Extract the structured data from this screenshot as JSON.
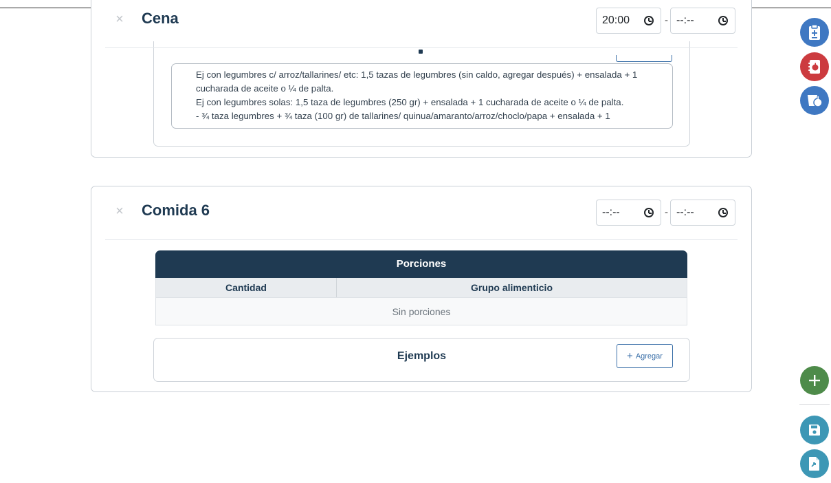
{
  "meals": [
    {
      "title": "Cena",
      "time_from": "20:00",
      "time_to": "--:--",
      "examples_text": [
        "Ej con legumbres c/ arroz/tallarines/ etc: 1,5 tazas de legumbres (sin caldo, agregar después) + ensalada + 1",
        "cucharada de aceite o ¼ de palta.",
        "Ej con legumbres solas: 1,5 taza de legumbres (250 gr) + ensalada + 1 cucharada de aceite o ¼ de palta.",
        "- ¾ taza legumbres + ¾ taza (100 gr) de tallarines/ quinua/amaranto/arroz/choclo/papa +  ensalada + 1"
      ]
    },
    {
      "title": "Comida 6",
      "time_from": "--:--",
      "time_to": "--:--",
      "portions": {
        "title": "Porciones",
        "columns": [
          "Cantidad",
          "Grupo alimenticio"
        ],
        "empty_text": "Sin porciones"
      },
      "examples": {
        "title": "Ejemplos",
        "add_label": "Agregar"
      }
    }
  ],
  "time_separator": "-",
  "close_glyph": "×",
  "floating_buttons": [
    {
      "icon": "clipboard-plus-icon",
      "color": "#3f78c2"
    },
    {
      "icon": "notebook-apple-icon",
      "color": "#cc3b3f"
    },
    {
      "icon": "fruit-bowl-icon",
      "color": "#3f78c2"
    },
    {
      "icon": "plus-icon",
      "color": "#4e8b4a"
    },
    {
      "icon": "save-icon",
      "color": "#3d97b5"
    },
    {
      "icon": "file-export-icon",
      "color": "#3d97b5"
    }
  ],
  "colors": {
    "primary_dark": "#1f3a52",
    "button_blue": "#3a6fa8"
  }
}
